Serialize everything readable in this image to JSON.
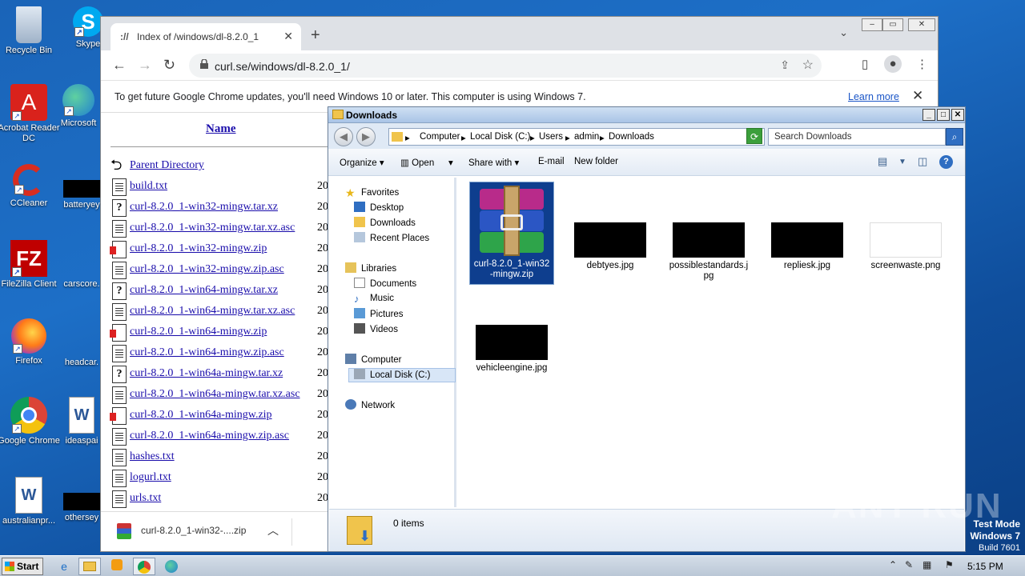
{
  "desktop": {
    "icons": [
      {
        "label": "Recycle Bin"
      },
      {
        "label": "Skype"
      },
      {
        "label": "Acrobat Reader DC"
      },
      {
        "label": "Microsoft"
      },
      {
        "label": "CCleaner"
      },
      {
        "label": "batteryey"
      },
      {
        "label": "FileZilla Client"
      },
      {
        "label": "carscore."
      },
      {
        "label": "Firefox"
      },
      {
        "label": "headcar."
      },
      {
        "label": "Google Chrome"
      },
      {
        "label": "ideaspai"
      },
      {
        "label": "australianpr..."
      },
      {
        "label": "othersey"
      }
    ],
    "test_mode": {
      "line1": "Test Mode",
      "line2": "Windows 7",
      "line3": "Build 7601"
    },
    "watermark": "ANY RUN"
  },
  "chrome": {
    "tab_title": "Index of /windows/dl-8.2.0_1",
    "url": "curl.se/windows/dl-8.2.0_1/",
    "infobar_message": "To get future Google Chrome updates, you'll need Windows 10 or later. This computer is using Windows 7.",
    "infobar_link": "Learn more",
    "listing_header": "Name",
    "parent_directory": "Parent Directory",
    "files": [
      {
        "name": "build.txt",
        "type": "txt",
        "date": "20"
      },
      {
        "name": "curl-8.2.0_1-win32-mingw.tar.xz",
        "type": "unknown",
        "date": "20"
      },
      {
        "name": "curl-8.2.0_1-win32-mingw.tar.xz.asc",
        "type": "txt",
        "date": "20"
      },
      {
        "name": "curl-8.2.0_1-win32-mingw.zip",
        "type": "zip",
        "date": "20"
      },
      {
        "name": "curl-8.2.0_1-win32-mingw.zip.asc",
        "type": "txt",
        "date": "20"
      },
      {
        "name": "curl-8.2.0_1-win64-mingw.tar.xz",
        "type": "unknown",
        "date": "20"
      },
      {
        "name": "curl-8.2.0_1-win64-mingw.tar.xz.asc",
        "type": "txt",
        "date": "20"
      },
      {
        "name": "curl-8.2.0_1-win64-mingw.zip",
        "type": "zip",
        "date": "20"
      },
      {
        "name": "curl-8.2.0_1-win64-mingw.zip.asc",
        "type": "txt",
        "date": "20"
      },
      {
        "name": "curl-8.2.0_1-win64a-mingw.tar.xz",
        "type": "unknown",
        "date": "20"
      },
      {
        "name": "curl-8.2.0_1-win64a-mingw.tar.xz.asc",
        "type": "txt",
        "date": "20"
      },
      {
        "name": "curl-8.2.0_1-win64a-mingw.zip",
        "type": "zip",
        "date": "20"
      },
      {
        "name": "curl-8.2.0_1-win64a-mingw.zip.asc",
        "type": "txt",
        "date": "20"
      },
      {
        "name": "hashes.txt",
        "type": "txt",
        "date": "20"
      },
      {
        "name": "logurl.txt",
        "type": "txt",
        "date": "20"
      },
      {
        "name": "urls.txt",
        "type": "txt",
        "date": "20"
      }
    ],
    "download_item": "curl-8.2.0_1-win32-....zip"
  },
  "explorer": {
    "title": "Downloads",
    "breadcrumb": [
      "Computer",
      "Local Disk (C:)",
      "Users",
      "admin",
      "Downloads"
    ],
    "search_placeholder": "Search Downloads",
    "commands": {
      "organize": "Organize",
      "open": "Open",
      "share_with": "Share with",
      "email": "E-mail",
      "new_folder": "New folder"
    },
    "nav": {
      "favorites": "Favorites",
      "desktop": "Desktop",
      "downloads": "Downloads",
      "recent_places": "Recent Places",
      "libraries": "Libraries",
      "documents": "Documents",
      "music": "Music",
      "pictures": "Pictures",
      "videos": "Videos",
      "computer": "Computer",
      "local_disk": "Local Disk (C:)",
      "network": "Network"
    },
    "items": [
      {
        "name": "curl-8.2.0_1-win32-mingw.zip",
        "selected": true
      },
      {
        "name": "debtyes.jpg"
      },
      {
        "name": "possiblestandards.jpg"
      },
      {
        "name": "repliesk.jpg"
      },
      {
        "name": "screenwaste.png"
      },
      {
        "name": "vehicleengine.jpg"
      }
    ],
    "status": "0 items"
  },
  "taskbar": {
    "start": "Start",
    "clock": "5:15 PM"
  }
}
